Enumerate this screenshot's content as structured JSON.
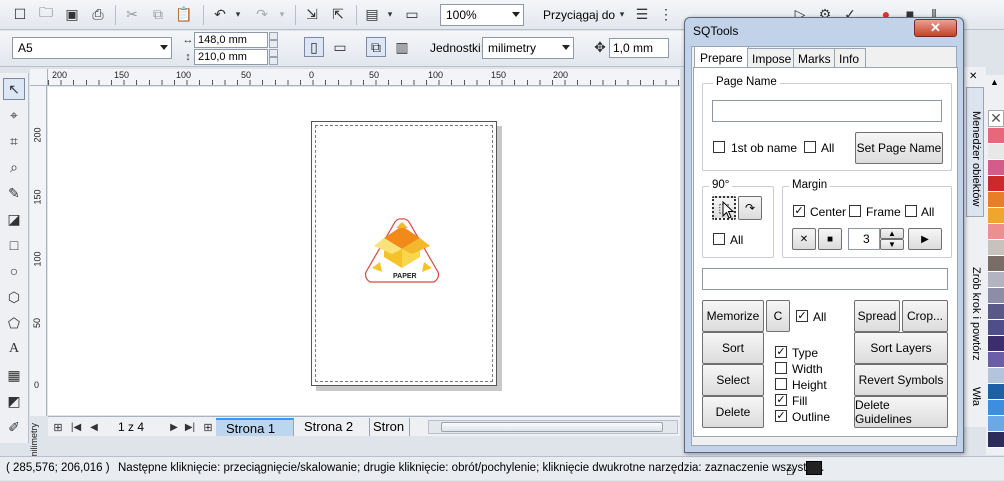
{
  "toolbar": {
    "zoom": "100%",
    "snap": "Przyciągaj do"
  },
  "propbar": {
    "page_size": "A5",
    "width": "148,0 mm",
    "height": "210,0 mm",
    "units_label": "Jednostki:",
    "units": "milimetry",
    "nudge": "1,0 mm"
  },
  "ruler_h": [
    "200",
    "150",
    "100",
    "50",
    "0",
    "50",
    "100",
    "150",
    "200"
  ],
  "ruler_v": [
    "200",
    "150",
    "100",
    "50",
    "0"
  ],
  "ruler_unit": "milimetry",
  "logo_text": "PAPER",
  "page_nav": {
    "counter": "1 z 4",
    "tabs": [
      "Strona 1",
      "Strona 2",
      "Stron"
    ]
  },
  "status": {
    "coords": "( 285,576; 206,016 )",
    "message": "Następne kliknięcie: przeciągnięcie/skalowanie; drugie kliknięcie: obrót/pochylenie; kliknięcie dwukrotne narzędzia: zaznaczenie wszystki..."
  },
  "dialog": {
    "title": "SQTools",
    "close": "✕",
    "tabs": [
      "Prepare",
      "Impose",
      "Marks",
      "Info"
    ],
    "page_name_group": "Page Name",
    "first_ob_name": "1st ob name",
    "all": "All",
    "set_page_name": "Set Page Name",
    "rot_group": "90°",
    "margin_group": "Margin",
    "center": "Center",
    "frame": "Frame",
    "margin_value": "3",
    "memorize": "Memorize",
    "c": "C",
    "spread": "Spread",
    "crop": "Crop...",
    "sort": "Sort",
    "select": "Select",
    "delete": "Delete",
    "type": "Type",
    "width": "Width",
    "height": "Height",
    "fill": "Fill",
    "outline": "Outline",
    "sort_layers": "Sort Layers",
    "revert_symbols": "Revert Symbols",
    "delete_guidelines": "Delete Guidelines"
  },
  "docker": {
    "objects": "Menedżer obiektów",
    "steps": "Zrób krok i powtórz",
    "other": "Wła"
  },
  "palette": [
    "#e9677a",
    "#e8e8e8",
    "#d45b8a",
    "#cc2a2a",
    "#e87f28",
    "#f0a62a",
    "#ee8f8f",
    "#c7c2bb",
    "#7a6d66",
    "#b3b3c2",
    "#8d8da8",
    "#595989",
    "#4e4e8a",
    "#3b2d6e",
    "#6b5ea6",
    "#b5c4dd",
    "#1f5fa6",
    "#3e8ee0",
    "#6aa9e6",
    "#2b2b5c"
  ],
  "colors": {
    "accent": "#3399ff",
    "dialog_frame": "#c2d3e9",
    "close_red": "#c7412a",
    "logo_orange": "#f28a1a",
    "logo_yellow": "#f6c22a"
  }
}
